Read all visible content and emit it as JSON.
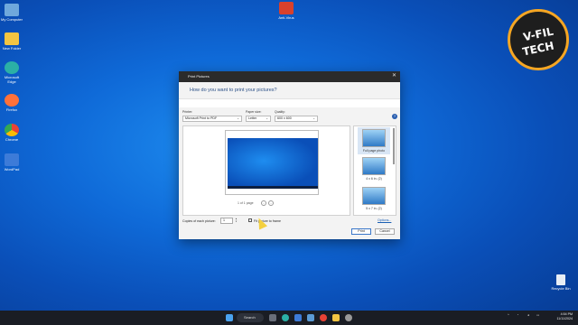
{
  "desktop": {
    "icons": [
      {
        "label": "My Computer",
        "icon": "computer-icon",
        "color": "#6fa8dc"
      },
      {
        "label": "New Folder",
        "icon": "folder-icon",
        "color": "#f4c542"
      },
      {
        "label": "Microsoft Edge",
        "icon": "edge-icon",
        "color": "#2bb0a6"
      },
      {
        "label": "Firefox",
        "icon": "firefox-icon",
        "color": "#ff7139"
      },
      {
        "label": "Chrome",
        "icon": "chrome-icon",
        "color": "#e94235"
      },
      {
        "label": "WordPad",
        "icon": "wordpad-icon",
        "color": "#3d7bd8"
      }
    ],
    "top_app": {
      "label": "Anti-Virus",
      "icon": "antivirus-icon",
      "color": "#d9412c"
    },
    "recycle_bin": "Recycle Bin",
    "logo": {
      "line1": "V-FIL",
      "line2": "TECH"
    }
  },
  "dialog": {
    "title": "Print Pictures",
    "question": "How do you want to print your pictures?",
    "printer_label": "Printer:",
    "printer_value": "Microsoft Print to PDF",
    "paper_size_label": "Paper size:",
    "paper_size_value": "Letter",
    "quality_label": "Quality:",
    "quality_value": "600 x 600",
    "help": "?",
    "page_info": "1 of 1 page",
    "layouts": [
      {
        "label": "Full page photo",
        "selected": true
      },
      {
        "label": "4 x 6 in. (2)",
        "selected": false
      },
      {
        "label": "5 x 7 in. (2)",
        "selected": false
      }
    ],
    "copies_label": "Copies of each picture:",
    "copies_value": "1",
    "fit_label": "Fit picture to frame",
    "options_link": "Options...",
    "print_button": "Print",
    "cancel_button": "Cancel"
  },
  "taskbar": {
    "search_label": "Search",
    "clock_time": "4:54 PM",
    "clock_date": "11/11/2024"
  }
}
